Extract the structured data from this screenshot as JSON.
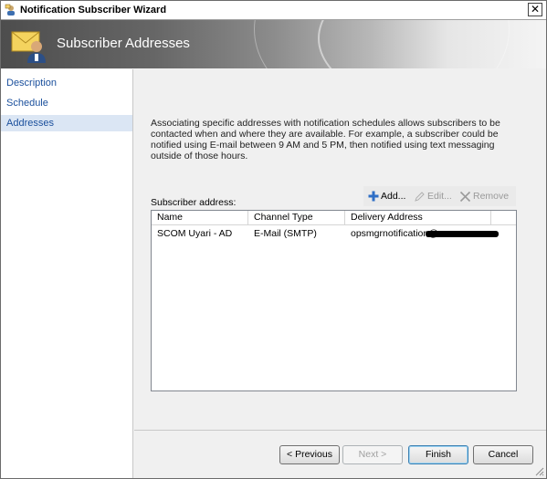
{
  "window": {
    "title": "Notification Subscriber Wizard",
    "close_glyph": "✕"
  },
  "banner": {
    "heading": "Subscriber Addresses",
    "icon": "envelope-person-icon"
  },
  "nav": {
    "items": [
      {
        "label": "Description",
        "active": false
      },
      {
        "label": "Schedule",
        "active": false
      },
      {
        "label": "Addresses",
        "active": true
      }
    ]
  },
  "content": {
    "description": "Associating specific addresses with notification schedules allows subscribers to be contacted when and where they are available. For example, a subscriber could be notified using E-mail between 9 AM and 5 PM, then notified using text messaging outside of those hours.",
    "subscriber_address_label": "Subscriber address:",
    "toolbar": {
      "add_label": "Add...",
      "edit_label": "Edit...",
      "remove_label": "Remove"
    },
    "table": {
      "columns": [
        "Name",
        "Channel Type",
        "Delivery Address"
      ],
      "rows": [
        {
          "name": "SCOM Uyari - AD",
          "channel_type": "E-Mail (SMTP)",
          "delivery_address": "opsmgrnotification@"
        }
      ]
    }
  },
  "footer": {
    "previous_label": "< Previous",
    "next_label": "Next >",
    "finish_label": "Finish",
    "cancel_label": "Cancel"
  },
  "colors": {
    "nav_link": "#1a4f9c",
    "nav_active_bg": "#dbe6f4",
    "add_icon": "#2f6fc6"
  }
}
